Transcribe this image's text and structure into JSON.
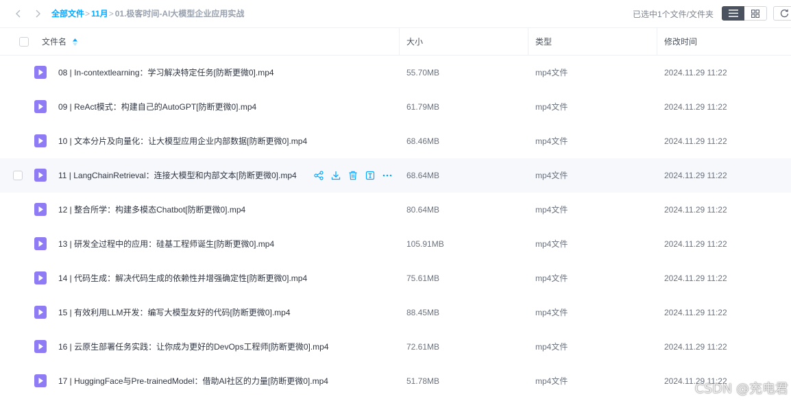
{
  "breadcrumb": {
    "items": [
      "全部文件",
      "11月"
    ],
    "separator": ">",
    "current": "01.极客时间-AI大模型企业应用实战"
  },
  "toolbar": {
    "selection_info": "已选中1个文件/文件夹",
    "view_mode": "list"
  },
  "table": {
    "columns": {
      "name": "文件名",
      "size": "大小",
      "type": "类型",
      "mtime": "修改时间"
    },
    "rows": [
      {
        "name": "08 | In-contextlearning：学习解决特定任务[防断更微0].mp4",
        "size": "55.70MB",
        "type": "mp4文件",
        "mtime": "2024.11.29 11:22"
      },
      {
        "name": "09 | ReAct模式：构建自己的AutoGPT[防断更微0].mp4",
        "size": "61.79MB",
        "type": "mp4文件",
        "mtime": "2024.11.29 11:22"
      },
      {
        "name": "10 | 文本分片及向量化：让大模型应用企业内部数据[防断更微0].mp4",
        "size": "68.46MB",
        "type": "mp4文件",
        "mtime": "2024.11.29 11:22"
      },
      {
        "name": "11 | LangChainRetrieval：连接大模型和内部文本[防断更微0].mp4",
        "size": "68.64MB",
        "type": "mp4文件",
        "mtime": "2024.11.29 11:22"
      },
      {
        "name": "12 | 整合所学：构建多模态Chatbot[防断更微0].mp4",
        "size": "80.64MB",
        "type": "mp4文件",
        "mtime": "2024.11.29 11:22"
      },
      {
        "name": "13 | 研发全过程中的应用：硅基工程师诞生[防断更微0].mp4",
        "size": "105.91MB",
        "type": "mp4文件",
        "mtime": "2024.11.29 11:22"
      },
      {
        "name": "14 | 代码生成：解决代码生成的依赖性并增强确定性[防断更微0].mp4",
        "size": "75.61MB",
        "type": "mp4文件",
        "mtime": "2024.11.29 11:22"
      },
      {
        "name": "15 | 有效利用LLM开发：编写大模型友好的代码[防断更微0].mp4",
        "size": "88.45MB",
        "type": "mp4文件",
        "mtime": "2024.11.29 11:22"
      },
      {
        "name": "16 | 云原生部署任务实践：让你成为更好的DevOps工程师[防断更微0].mp4",
        "size": "72.61MB",
        "type": "mp4文件",
        "mtime": "2024.11.29 11:22"
      },
      {
        "name": "17 | HuggingFace与Pre-trainedModel：借助AI社区的力量[防断更微0].mp4",
        "size": "51.78MB",
        "type": "mp4文件",
        "mtime": "2024.11.29 11:22"
      }
    ],
    "hovered_row_actions": [
      "share-icon",
      "download-icon",
      "delete-icon",
      "info-icon",
      "more-icon"
    ]
  },
  "icons": {
    "file": "video-file-icon",
    "back": "chevron-left-icon",
    "forward": "chevron-right-icon",
    "sort": "sort-icon",
    "list_view": "list-view-icon",
    "grid_view": "grid-view-icon",
    "refresh": "refresh-icon"
  },
  "colors": {
    "accent": "#06a7ff",
    "file_icon": "#8f7cf5",
    "hover_row": "#f6f8fc"
  },
  "watermark": "CSDN @充电君"
}
